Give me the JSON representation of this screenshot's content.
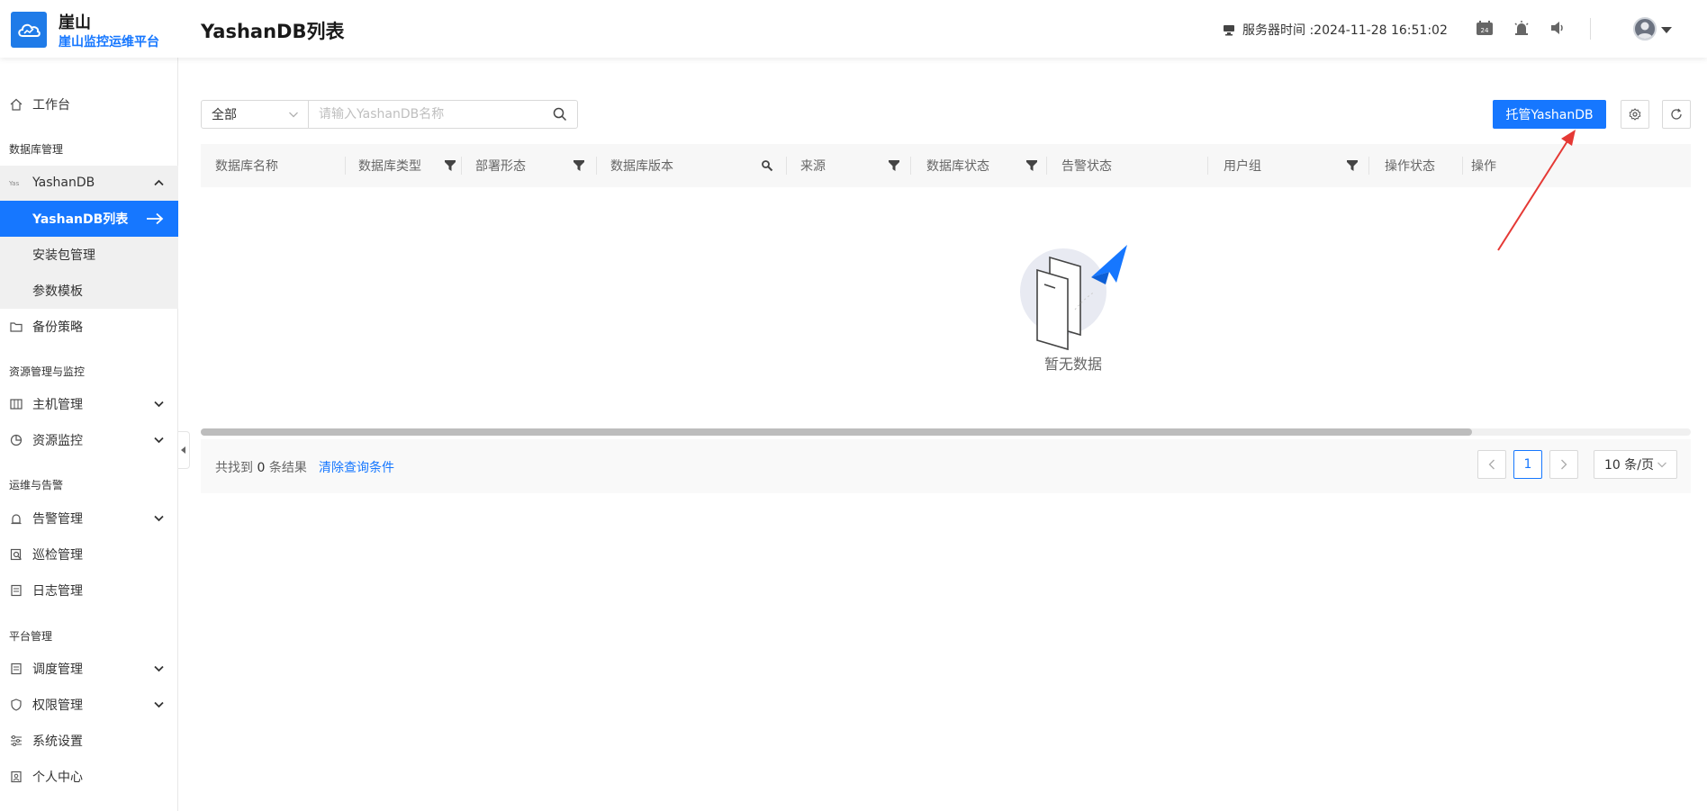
{
  "app": {
    "brand_name": "崖山",
    "brand_sub": "崖山监控运维平台",
    "page_title": "YashanDB列表"
  },
  "header": {
    "server_time_label": "服务器时间 :2024-11-28 16:51:02"
  },
  "sidebar": {
    "workbench": "工作台",
    "groups": {
      "db": "数据库管理",
      "resource": "资源管理与监控",
      "ops": "运维与告警",
      "platform": "平台管理"
    },
    "yashandb": "YashanDB",
    "yashandb_list": "YashanDB列表",
    "install_pkg": "安装包管理",
    "param_tpl": "参数模板",
    "backup": "备份策略",
    "host": "主机管理",
    "monitor": "资源监控",
    "alarm": "告警管理",
    "inspection": "巡检管理",
    "log": "日志管理",
    "schedule": "调度管理",
    "permission": "权限管理",
    "system": "系统设置",
    "personal": "个人中心"
  },
  "toolbar": {
    "filter_value": "全部",
    "search_placeholder": "请输入YashanDB名称",
    "host_button": "托管YashanDB"
  },
  "table": {
    "columns": [
      "数据库名称",
      "数据库类型",
      "部署形态",
      "数据库版本",
      "来源",
      "数据库状态",
      "告警状态",
      "用户组",
      "操作状态",
      "操作"
    ],
    "empty_text": "暂无数据"
  },
  "footer": {
    "result_prefix": "共找到",
    "result_count": "0",
    "result_suffix": "条结果",
    "clear_label": "清除查询条件",
    "current_page": "1",
    "page_size": "10 条/页"
  },
  "colors": {
    "primary": "#1677ff",
    "annotation": "#e53935"
  }
}
